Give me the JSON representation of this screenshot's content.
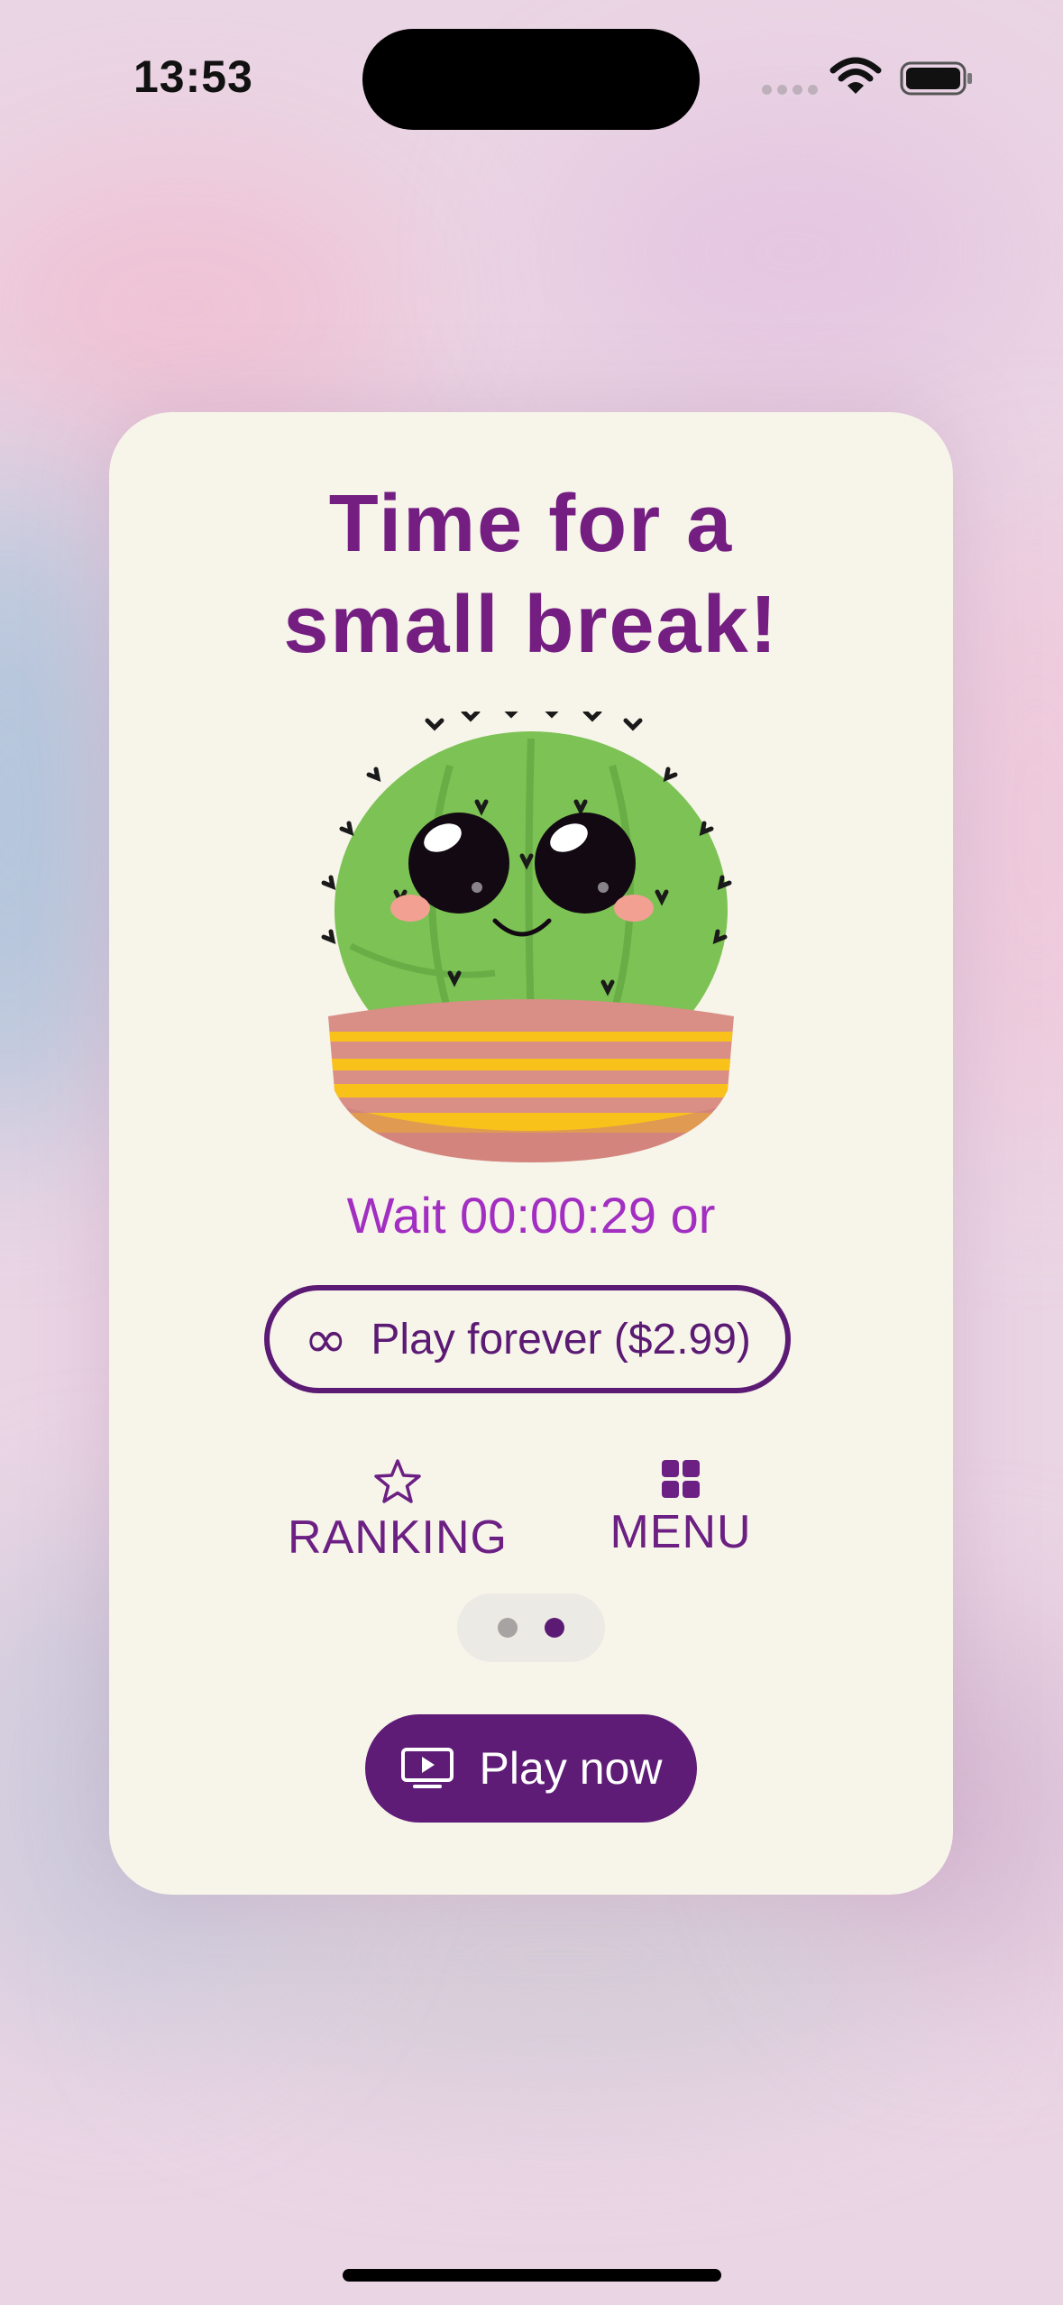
{
  "status_bar": {
    "time": "13:53"
  },
  "card": {
    "title_line1": "Time for a",
    "title_line2": "small break!",
    "wait_text": "Wait 00:00:29 or",
    "forever_button": {
      "icon": "infinity-icon",
      "label": "Play forever ($2.99)"
    },
    "nav": [
      {
        "icon": "star-icon",
        "label": "RANKING"
      },
      {
        "icon": "grid-icon",
        "label": "MENU"
      }
    ],
    "pager": {
      "pages": 2,
      "active_page": 2
    },
    "play_button": {
      "icon": "play-screen-icon",
      "label": "Play now"
    }
  },
  "colors": {
    "title": "#741e82",
    "wait_text": "#a22ec2",
    "accent": "#5e1c77",
    "card_bg": "#f7f4ea"
  }
}
